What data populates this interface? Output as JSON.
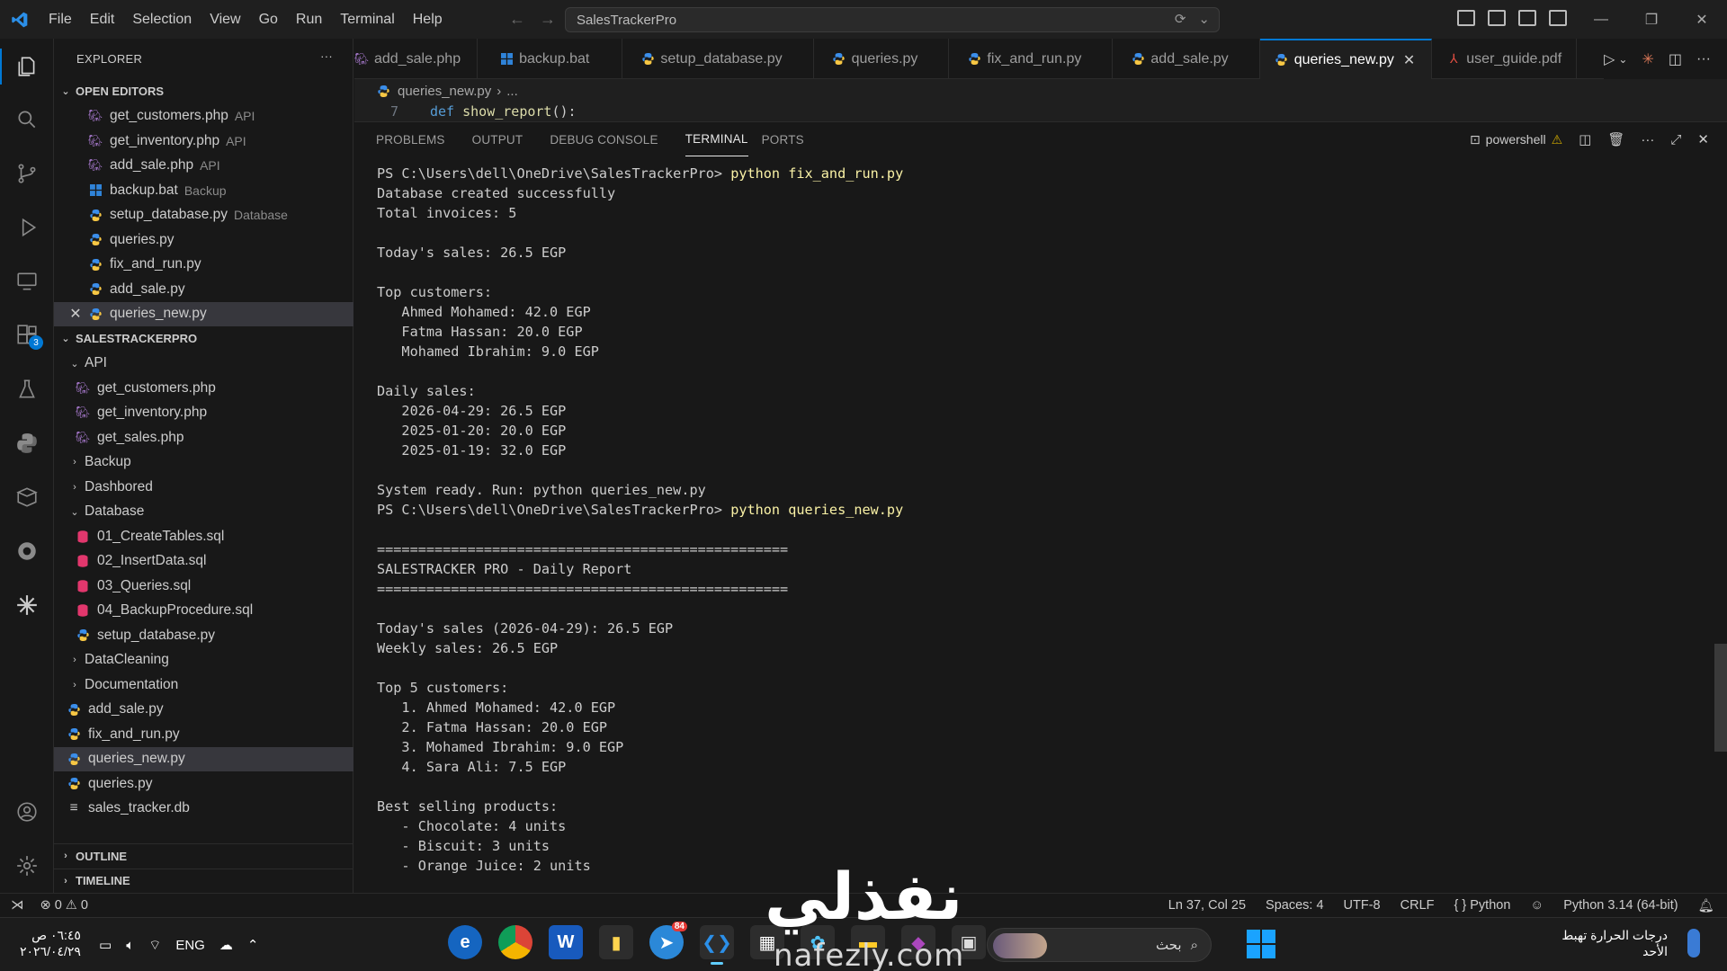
{
  "titlebar": {
    "menu": [
      "File",
      "Edit",
      "Selection",
      "View",
      "Go",
      "Run",
      "Terminal",
      "Help"
    ],
    "search_text": "SalesTrackerPro"
  },
  "sidebar": {
    "title": "EXPLORER",
    "open_editors_label": "OPEN EDITORS",
    "open_editors": [
      {
        "name": "get_customers.php",
        "hint": "API",
        "icon": "php-icon"
      },
      {
        "name": "get_inventory.php",
        "hint": "API",
        "icon": "php-icon"
      },
      {
        "name": "add_sale.php",
        "hint": "API",
        "icon": "php-icon"
      },
      {
        "name": "backup.bat",
        "hint": "Backup",
        "icon": "windows-icon"
      },
      {
        "name": "setup_database.py",
        "hint": "Database",
        "icon": "python-icon"
      },
      {
        "name": "queries.py",
        "hint": "",
        "icon": "python-icon"
      },
      {
        "name": "fix_and_run.py",
        "hint": "",
        "icon": "python-icon"
      },
      {
        "name": "add_sale.py",
        "hint": "",
        "icon": "python-icon"
      },
      {
        "name": "queries_new.py",
        "hint": "",
        "icon": "python-icon"
      }
    ],
    "project_label": "SALESTRACKERPRO",
    "tree": {
      "api": "API",
      "api_files": [
        "get_customers.php",
        "get_inventory.php",
        "get_sales.php"
      ],
      "backup": "Backup",
      "dashbored": "Dashbored",
      "database": "Database",
      "database_files": [
        "01_CreateTables.sql",
        "02_InsertData.sql",
        "03_Queries.sql",
        "04_BackupProcedure.sql",
        "setup_database.py"
      ],
      "datacleaning": "DataCleaning",
      "documentation": "Documentation",
      "root_files": [
        "add_sale.py",
        "fix_and_run.py",
        "queries_new.py",
        "queries.py",
        "sales_tracker.db"
      ]
    },
    "outline_label": "OUTLINE",
    "timeline_label": "TIMELINE"
  },
  "tabs": [
    {
      "label": "add_sale.php",
      "icon": "php-icon"
    },
    {
      "label": "backup.bat",
      "icon": "windows-icon"
    },
    {
      "label": "setup_database.py",
      "icon": "python-icon"
    },
    {
      "label": "queries.py",
      "icon": "python-icon"
    },
    {
      "label": "fix_and_run.py",
      "icon": "python-icon"
    },
    {
      "label": "add_sale.py",
      "icon": "python-icon"
    },
    {
      "label": "queries_new.py",
      "icon": "python-icon"
    },
    {
      "label": "user_guide.pdf",
      "icon": "pdf-icon"
    }
  ],
  "breadcrumb": {
    "file": "queries_new.py",
    "rest": "..."
  },
  "code": {
    "line_number": "7",
    "keyword": "def",
    "function": "show_report",
    "punct": "():"
  },
  "panel": {
    "tabs": [
      "PROBLEMS",
      "OUTPUT",
      "DEBUG CONSOLE",
      "TERMINAL",
      "PORTS"
    ],
    "shell": "powershell"
  },
  "terminal": {
    "prompt": "PS C:\\Users\\dell\\OneDrive\\SalesTrackerPro>",
    "command1": "python fix_and_run.py",
    "output1": "Database created successfully\nTotal invoices: 5\n\nToday's sales: 26.5 EGP\n\nTop customers:\n   Ahmed Mohamed: 42.0 EGP\n   Fatma Hassan: 20.0 EGP\n   Mohamed Ibrahim: 9.0 EGP\n\nDaily sales:\n   2026-04-29: 26.5 EGP\n   2025-01-20: 20.0 EGP\n   2025-01-19: 32.0 EGP\n\nSystem ready. Run: python queries_new.py",
    "command2": "python queries_new.py",
    "output2": "\n==================================================\nSALESTRACKER PRO - Daily Report\n==================================================\n\nToday's sales (2026-04-29): 26.5 EGP\nWeekly sales: 26.5 EGP\n\nTop 5 customers:\n   1. Ahmed Mohamed: 42.0 EGP\n   2. Fatma Hassan: 20.0 EGP\n   3. Mohamed Ibrahim: 9.0 EGP\n   4. Sara Ali: 7.5 EGP\n\nBest selling products:\n   - Chocolate: 4 units\n   - Biscuit: 3 units\n   - Orange Juice: 2 units"
  },
  "statusbar": {
    "errors": "0",
    "warnings": "0",
    "position": "Ln 37, Col 25",
    "spaces": "Spaces: 4",
    "encoding": "UTF-8",
    "eol": "CRLF",
    "language": "Python",
    "interpreter": "Python 3.14 (64-bit)"
  },
  "watermark": {
    "arabic": "نفذلي",
    "url": "nafezly.com"
  },
  "taskbar": {
    "time": "٠٦:٤٥ ص",
    "date": "٢٠٢٦/٠٤/٢٩",
    "lang": "ENG",
    "search": "بحث",
    "weather_line1": "درجات الحرارة تهبط",
    "weather_line2": "الأحد",
    "mail_badge": "84"
  },
  "colors": {
    "accent": "#0078d4",
    "terminal_cmd": "#f9f1a5",
    "background": "#181818"
  }
}
